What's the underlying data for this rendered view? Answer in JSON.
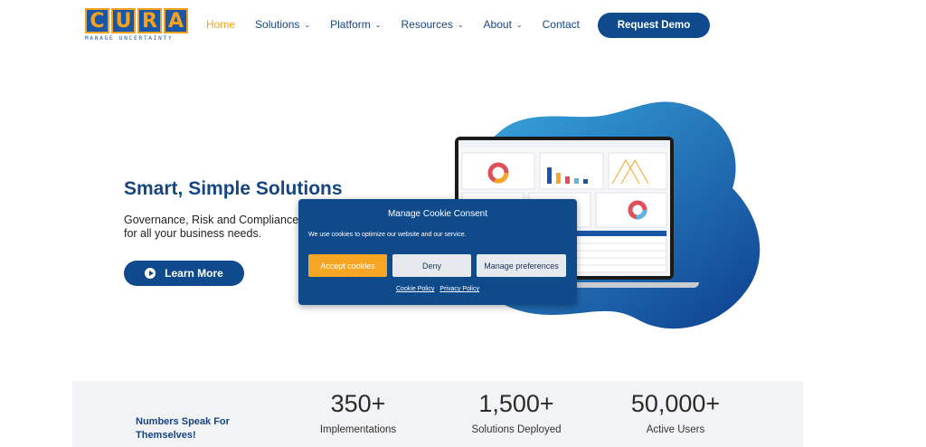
{
  "logo": {
    "letters": [
      "C",
      "U",
      "R",
      "A"
    ],
    "tagline": "MANAGE UNCERTAINTY",
    "colors": {
      "primary": "#1a56a6",
      "accent": "#f4a21e"
    }
  },
  "nav": {
    "items": [
      {
        "label": "Home",
        "active": true,
        "dropdown": false
      },
      {
        "label": "Solutions",
        "active": false,
        "dropdown": true
      },
      {
        "label": "Platform",
        "active": false,
        "dropdown": true
      },
      {
        "label": "Resources",
        "active": false,
        "dropdown": true
      },
      {
        "label": "About",
        "active": false,
        "dropdown": true
      },
      {
        "label": "Contact",
        "active": false,
        "dropdown": false
      }
    ],
    "cta_label": "Request Demo"
  },
  "hero": {
    "title": "Smart, Simple Solutions",
    "subtitle": "Governance, Risk and Compliance for all your business needs.",
    "button_label": "Learn More"
  },
  "cookie": {
    "title": "Manage Cookie Consent",
    "text": "We use cookies to optimize our website and our service.",
    "accept_label": "Accept cookies",
    "deny_label": "Deny",
    "prefs_label": "Manage preferences",
    "links": [
      "Cookie Policy",
      "Privacy Policy"
    ]
  },
  "stats": {
    "heading": "Numbers Speak For Themselves!",
    "items": [
      {
        "value": "350+",
        "label": "Implementations"
      },
      {
        "value": "1,500+",
        "label": "Solutions Deployed"
      },
      {
        "value": "50,000+",
        "label": "Active Users"
      }
    ]
  },
  "colors": {
    "brand_blue": "#0e4a8c",
    "accent_orange": "#f2a21d",
    "stats_bg": "#f2f3f5"
  }
}
